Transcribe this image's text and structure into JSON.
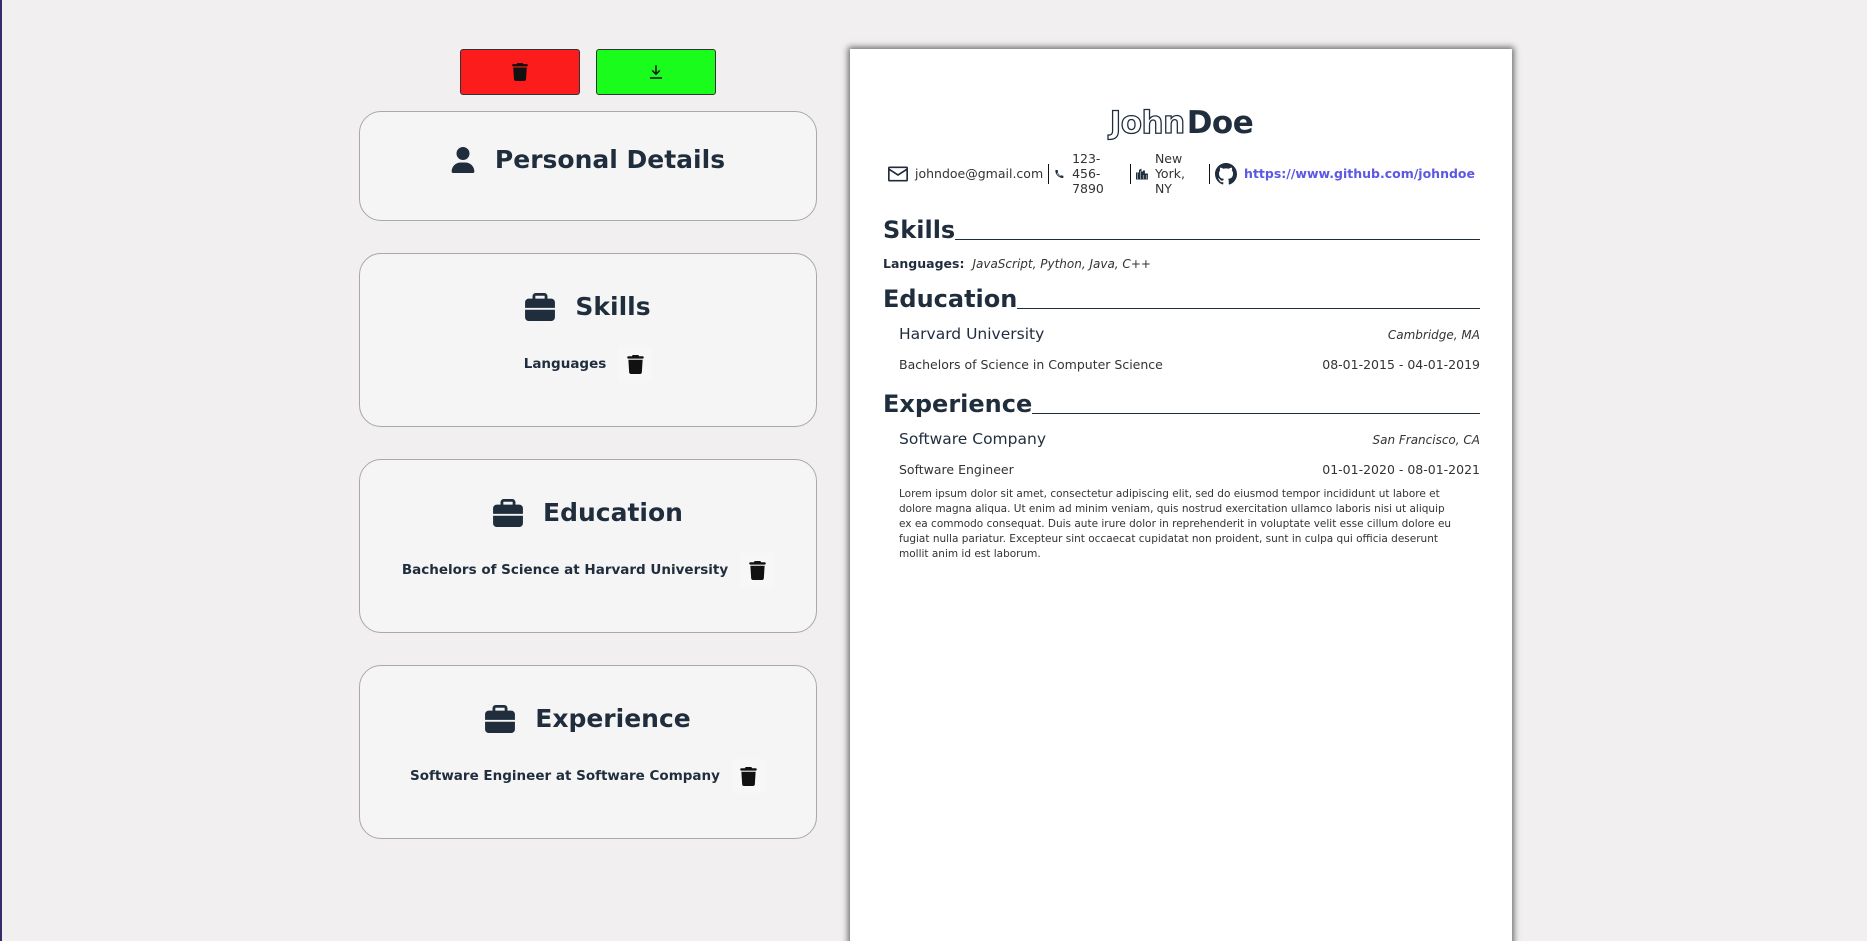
{
  "toolbar": {
    "clear_icon": "trash-icon",
    "download_icon": "download-icon"
  },
  "editor": {
    "personal": {
      "title": "Personal Details",
      "icon": "user-icon"
    },
    "skills": {
      "title": "Skills",
      "icon": "briefcase-icon",
      "items": [
        "Languages"
      ]
    },
    "education": {
      "title": "Education",
      "icon": "briefcase-icon",
      "items": [
        "Bachelors of Science at Harvard University"
      ]
    },
    "experience": {
      "title": "Experience",
      "icon": "briefcase-icon",
      "items": [
        "Software Engineer at Software Company"
      ]
    }
  },
  "resume": {
    "first_name": "John",
    "last_name": "Doe",
    "contact": {
      "email": "johndoe@gmail.com",
      "phone": "123-456-7890",
      "location": "New York, NY",
      "github": "https://www.github.com/johndoe"
    },
    "skills_title": "Skills",
    "skills": [
      {
        "label": "Languages:",
        "value": "JavaScript, Python, Java, C++"
      }
    ],
    "education_title": "Education",
    "education": [
      {
        "school": "Harvard University",
        "location": "Cambridge, MA",
        "degree": "Bachelors of Science in Computer Science",
        "dates": "08-01-2015 - 04-01-2019"
      }
    ],
    "experience_title": "Experience",
    "experience": [
      {
        "company": "Software Company",
        "location": "San Francisco, CA",
        "role": "Software Engineer",
        "dates": "01-01-2020 - 08-01-2021",
        "description": "Lorem ipsum dolor sit amet, consectetur adipiscing elit, sed do eiusmod tempor incididunt ut labore et dolore magna aliqua. Ut enim ad minim veniam, quis nostrud exercitation ullamco laboris nisi ut aliquip ex ea commodo consequat. Duis aute irure dolor in reprehenderit in voluptate velit esse cillum dolore eu fugiat nulla pariatur. Excepteur sint occaecat cupidatat non proident, sunt in culpa qui officia deserunt mollit anim id est laborum."
      }
    ]
  },
  "colors": {
    "clear_button": "#fc1c1c",
    "download_button": "#1afc1c",
    "text_dark": "#1f2d3d",
    "link": "#5b58e6"
  }
}
